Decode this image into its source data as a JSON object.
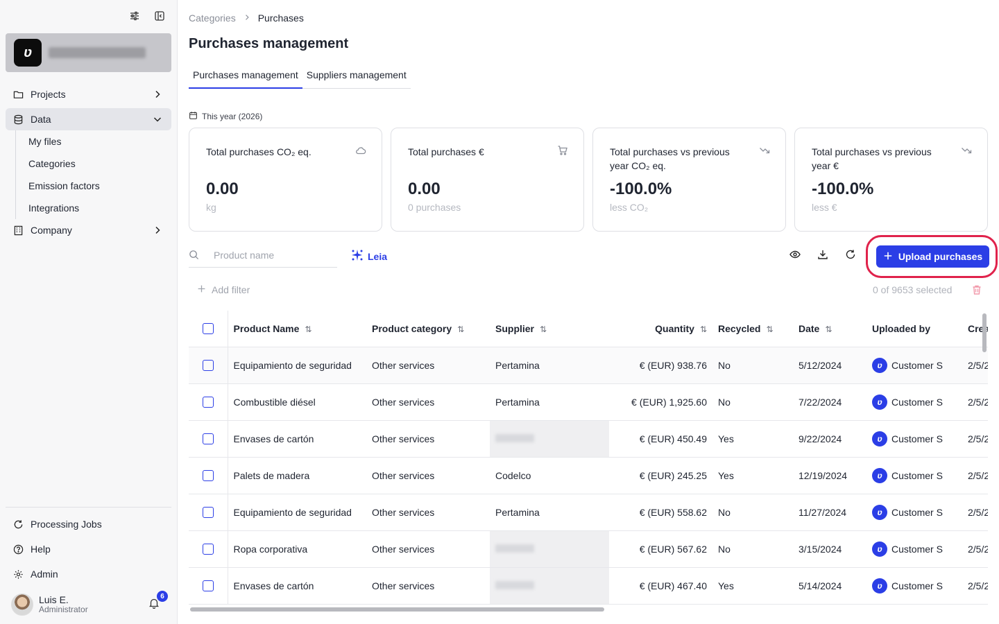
{
  "sidebar": {
    "nav": [
      {
        "label": "Projects",
        "icon": "folder-icon"
      },
      {
        "label": "Data",
        "icon": "database-icon"
      },
      {
        "label": "Company",
        "icon": "building-icon"
      }
    ],
    "data_sub": [
      "My files",
      "Categories",
      "Emission factors",
      "Integrations"
    ],
    "bottom": [
      {
        "label": "Processing Jobs",
        "icon": "refresh-icon"
      },
      {
        "label": "Help",
        "icon": "help-icon"
      },
      {
        "label": "Admin",
        "icon": "settings-icon"
      }
    ],
    "user": {
      "name": "Luis E.",
      "role": "Administrator",
      "notifications": "6"
    }
  },
  "breadcrumb": {
    "parent": "Categories",
    "current": "Purchases"
  },
  "page_title": "Purchases management",
  "tabs": [
    {
      "label": "Purchases management",
      "active": true
    },
    {
      "label": "Suppliers management",
      "active": false
    }
  ],
  "period": "This year (2026)",
  "kpis": [
    {
      "title": "Total purchases CO₂ eq.",
      "value": "0.00",
      "sub": "kg",
      "icon": "cloud-icon"
    },
    {
      "title": "Total purchases €",
      "value": "0.00",
      "sub": "0 purchases",
      "icon": "cart-icon"
    },
    {
      "title": "Total purchases vs previous year CO₂ eq.",
      "value": "-100.0%",
      "sub": "less CO₂",
      "icon": "trend-down-icon"
    },
    {
      "title": "Total purchases vs previous year €",
      "value": "-100.0%",
      "sub": "less €",
      "icon": "trend-down-icon"
    }
  ],
  "toolbar": {
    "search_placeholder": "Product name",
    "leia_label": "Leia",
    "upload_label": "Upload purchases",
    "add_filter_label": "Add filter",
    "selected_info": "0 of 9653 selected"
  },
  "table": {
    "columns": [
      "Product Name",
      "Product category",
      "Supplier",
      "Quantity",
      "Recycled",
      "Date",
      "Uploaded by",
      "Crea"
    ],
    "rows": [
      {
        "product": "Equipamiento de seguridad",
        "category": "Other services",
        "supplier": "Pertamina",
        "quantity": "€ (EUR) 938.76",
        "recycled": "No",
        "date": "5/12/2024",
        "uploaded_by": "Customer S",
        "created": "2/5/2"
      },
      {
        "product": "Combustible diésel",
        "category": "Other services",
        "supplier": "Pertamina",
        "quantity": "€ (EUR) 1,925.60",
        "recycled": "No",
        "date": "7/22/2024",
        "uploaded_by": "Customer S",
        "created": "2/5/2"
      },
      {
        "product": "Envases de cartón",
        "category": "Other services",
        "supplier": "",
        "quantity": "€ (EUR) 450.49",
        "recycled": "Yes",
        "date": "9/22/2024",
        "uploaded_by": "Customer S",
        "created": "2/5/2"
      },
      {
        "product": "Palets de madera",
        "category": "Other services",
        "supplier": "Codelco",
        "quantity": "€ (EUR) 245.25",
        "recycled": "Yes",
        "date": "12/19/2024",
        "uploaded_by": "Customer S",
        "created": "2/5/2"
      },
      {
        "product": "Equipamiento de seguridad",
        "category": "Other services",
        "supplier": "Pertamina",
        "quantity": "€ (EUR) 558.62",
        "recycled": "No",
        "date": "11/27/2024",
        "uploaded_by": "Customer S",
        "created": "2/5/2"
      },
      {
        "product": "Ropa corporativa",
        "category": "Other services",
        "supplier": "",
        "quantity": "€ (EUR) 567.62",
        "recycled": "No",
        "date": "3/15/2024",
        "uploaded_by": "Customer S",
        "created": "2/5/2"
      },
      {
        "product": "Envases de cartón",
        "category": "Other services",
        "supplier": "",
        "quantity": "€ (EUR) 467.40",
        "recycled": "Yes",
        "date": "5/14/2024",
        "uploaded_by": "Customer S",
        "created": "2/5/2"
      }
    ]
  },
  "colors": {
    "accent": "#2b3ee6",
    "highlight": "#e0224b"
  }
}
